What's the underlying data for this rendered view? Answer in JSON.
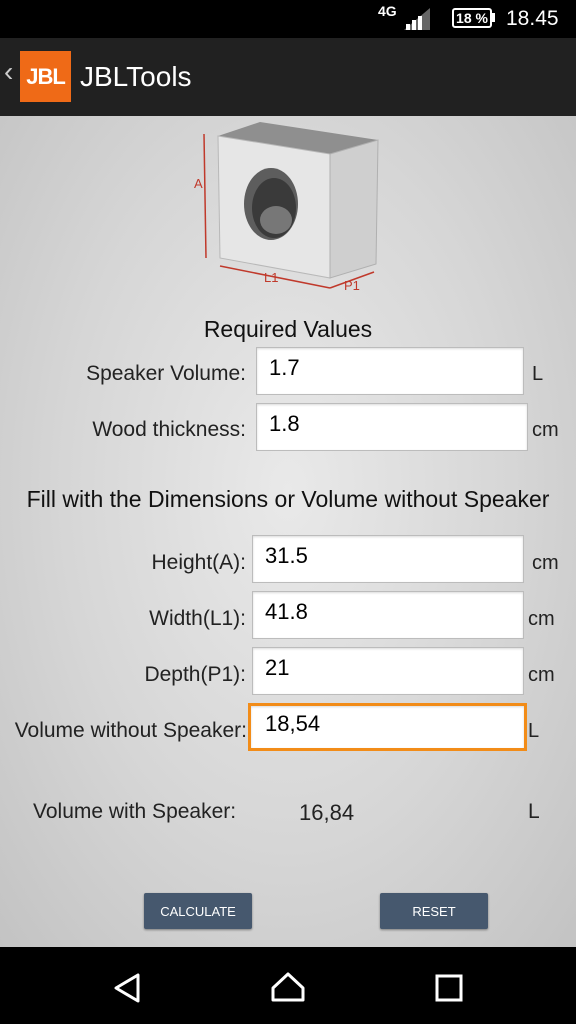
{
  "status_bar": {
    "network": "4G",
    "battery": "18 %",
    "time": "18.45"
  },
  "app_bar": {
    "logo_text": "JBL",
    "title": "JBLTools"
  },
  "illustration": {
    "label_a": "A",
    "label_l1": "L1",
    "label_p1": "P1"
  },
  "required": {
    "heading": "Required Values",
    "speaker_volume_label": "Speaker Volume:",
    "speaker_volume_value": "1.7",
    "speaker_volume_unit": "L",
    "wood_thickness_label": "Wood thickness:",
    "wood_thickness_value": "1.8",
    "wood_thickness_unit": "cm"
  },
  "dimensions": {
    "heading": "Fill with the Dimensions or Volume without Speaker",
    "height_label": "Height(A):",
    "height_value": "31.5",
    "height_unit": "cm",
    "width_label": "Width(L1):",
    "width_value": "41.8",
    "width_unit": "cm",
    "depth_label": "Depth(P1):",
    "depth_value": "21",
    "depth_unit": "cm",
    "volume_label": "Volume without Speaker:",
    "volume_value": "18,54",
    "volume_unit": "L"
  },
  "result": {
    "label": "Volume with Speaker:",
    "value": "16,84",
    "unit": "L"
  },
  "buttons": {
    "calculate": "CALCULATE",
    "reset": "RESET"
  },
  "colors": {
    "accent": "#f28c18",
    "button": "#46586e",
    "logo": "#ef6a17"
  },
  "nav_icons": [
    "back-icon",
    "home-icon",
    "recents-icon"
  ]
}
